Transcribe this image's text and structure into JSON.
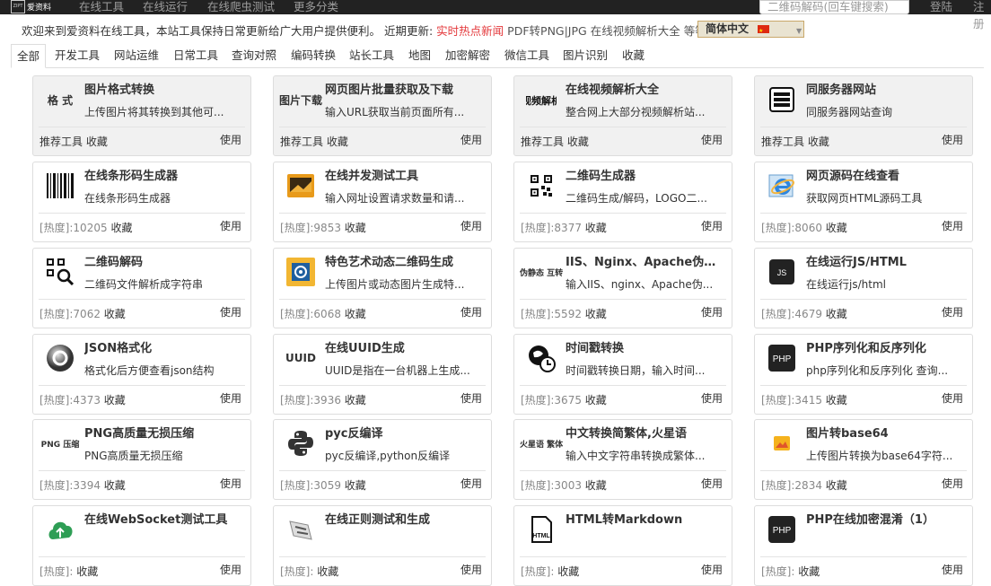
{
  "topbar": {
    "logo_text": "爱资料",
    "logo_box_text": "ZIPT",
    "nav": [
      "在线工具",
      "在线运行",
      "在线爬虫测试",
      "更多分类"
    ],
    "search_placeholder": "二维码解码(回车键搜索)",
    "login": "登陆",
    "register": "注册"
  },
  "notice": {
    "prefix": "欢迎来到爱资料在线工具，本站工具保持日常更新给广大用户提供便利。 近期更新:",
    "hot": "实时热点新闻",
    "links": [
      "PDF转PNG|JPG",
      "在线视频解析大全",
      "等等"
    ],
    "language": "简体中文"
  },
  "tabs": [
    "全部",
    "开发工具",
    "网站运维",
    "日常工具",
    "查询对照",
    "编码转换",
    "站长工具",
    "地图",
    "加密解密",
    "微信工具",
    "图片识别",
    "收藏"
  ],
  "labels": {
    "recommend": "推荐工具",
    "favorite": "收藏",
    "use": "使用",
    "heat_prefix": "[热度]:"
  },
  "cards": [
    {
      "title": "图片格式转换",
      "desc": "上传图片将其转换到其他可...",
      "heat": "",
      "icon": "image-format-icon",
      "icon_text": "格 式",
      "recommended": true
    },
    {
      "title": "网页图片批量获取及下载",
      "desc": "输入URL获取当前页面所有...",
      "heat": "",
      "icon": "image-download-icon",
      "icon_text": "图片下载",
      "recommended": true
    },
    {
      "title": "在线视频解析大全",
      "desc": "整合网上大部分视频解析站...",
      "heat": "",
      "icon": "video-parse-icon",
      "icon_text": "视频解析",
      "recommended": true
    },
    {
      "title": "同服务器网站",
      "desc": "同服务器网站查询",
      "heat": "",
      "icon": "server-icon",
      "icon_text": "",
      "recommended": true
    },
    {
      "title": "在线条形码生成器",
      "desc": "在线条形码生成器",
      "heat": "10205",
      "icon": "barcode-icon",
      "icon_text": "",
      "recommended": false
    },
    {
      "title": "在线并发测试工具",
      "desc": "输入网址设置请求数量和请...",
      "heat": "9853",
      "icon": "concurrency-test-icon",
      "icon_text": "",
      "recommended": false
    },
    {
      "title": "二维码生成器",
      "desc": "二维码生成/解码，LOGO二...",
      "heat": "8377",
      "icon": "qrcode-icon",
      "icon_text": "",
      "recommended": false
    },
    {
      "title": "网页源码在线查看",
      "desc": "获取网页HTML源码工具",
      "heat": "8060",
      "icon": "ie-browser-icon",
      "icon_text": "",
      "recommended": false
    },
    {
      "title": "二维码解码",
      "desc": "二维码文件解析成字符串",
      "heat": "7062",
      "icon": "qrcode-search-icon",
      "icon_text": "",
      "recommended": false
    },
    {
      "title": "特色艺术动态二维码生成",
      "desc": "上传图片或动态图片生成特...",
      "heat": "6068",
      "icon": "art-qrcode-icon",
      "icon_text": "",
      "recommended": false
    },
    {
      "title": "IIS、Nginx、Apache伪静态规则转换",
      "desc": "输入IIS、nginx、Apache伪...",
      "heat": "5592",
      "icon": "rewrite-icon",
      "icon_text": "伪静态 互转",
      "recommended": false
    },
    {
      "title": "在线运行JS/HTML",
      "desc": "在线运行js/html",
      "heat": "4679",
      "icon": "js-icon",
      "icon_text": "JS",
      "recommended": false
    },
    {
      "title": "JSON格式化",
      "desc": "格式化后方便查看json结构",
      "heat": "4373",
      "icon": "json-icon",
      "icon_text": "",
      "recommended": false
    },
    {
      "title": "在线UUID生成",
      "desc": "UUID是指在一台机器上生成...",
      "heat": "3936",
      "icon": "uuid-icon",
      "icon_text": "UUID",
      "recommended": false
    },
    {
      "title": "时间戳转换",
      "desc": "时间戳转换日期，输入时间...",
      "heat": "3675",
      "icon": "timestamp-icon",
      "icon_text": "",
      "recommended": false
    },
    {
      "title": "PHP序列化和反序列化",
      "desc": "php序列化和反序列化 查询...",
      "heat": "3415",
      "icon": "php-icon",
      "icon_text": "PHP",
      "recommended": false
    },
    {
      "title": "PNG高质量无损压缩",
      "desc": "PNG高质量无损压缩",
      "heat": "3394",
      "icon": "png-compress-icon",
      "icon_text": "PNG 压缩",
      "recommended": false
    },
    {
      "title": "pyc反编译",
      "desc": "pyc反编译,python反编译",
      "heat": "3059",
      "icon": "python-icon",
      "icon_text": "",
      "recommended": false
    },
    {
      "title": "中文转换简繁体,火星语",
      "desc": "输入中文字符串转换成繁体...",
      "heat": "3003",
      "icon": "chinese-convert-icon",
      "icon_text": "火星语 繁体",
      "recommended": false
    },
    {
      "title": "图片转base64",
      "desc": "上传图片转换为base64字符...",
      "heat": "2834",
      "icon": "base64-image-icon",
      "icon_text": "",
      "recommended": false
    },
    {
      "title": "在线WebSocket测试工具",
      "desc": "",
      "heat": "",
      "icon": "websocket-icon",
      "icon_text": "",
      "recommended": false
    },
    {
      "title": "在线正则测试和生成",
      "desc": "",
      "heat": "",
      "icon": "regex-icon",
      "icon_text": "",
      "recommended": false
    },
    {
      "title": "HTML转Markdown",
      "desc": "",
      "heat": "",
      "icon": "html-file-icon",
      "icon_text": "HTML",
      "recommended": false
    },
    {
      "title": "PHP在线加密混淆（1）",
      "desc": "",
      "heat": "",
      "icon": "php-encrypt-icon",
      "icon_text": "PHP",
      "recommended": false
    }
  ]
}
